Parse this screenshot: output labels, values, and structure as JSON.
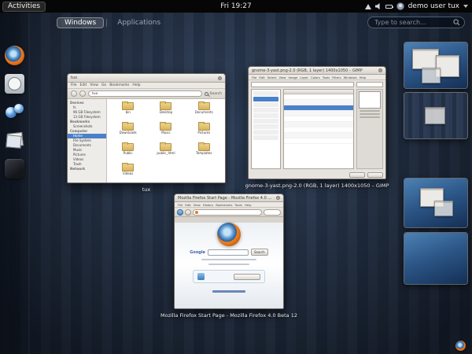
{
  "top_bar": {
    "activities_label": "Activities",
    "clock": "Fri 19:27",
    "user_name": "demo user tux"
  },
  "overview": {
    "tab_windows": "Windows",
    "tab_applications": "Applications",
    "search_placeholder": "Type to search..."
  },
  "dash": {
    "items": [
      "Firefox",
      "Screenshot",
      "Spheres App",
      "Image Viewer",
      "Media Player"
    ]
  },
  "windows": {
    "nautilus": {
      "title": "tux",
      "caption": "tux",
      "menus": [
        "File",
        "Edit",
        "View",
        "Go",
        "Bookmarks",
        "Help"
      ],
      "location": "tux",
      "search_label": "Search",
      "sidebar": [
        {
          "label": "Devices"
        },
        {
          "label": "fs"
        },
        {
          "label": "96 GB Filesystem"
        },
        {
          "label": "13 GB Filesystem"
        },
        {
          "label": "Bookmarks"
        },
        {
          "label": "Screenshots"
        },
        {
          "label": "Computer"
        },
        {
          "label": "Home"
        },
        {
          "label": "File System"
        },
        {
          "label": "Documents"
        },
        {
          "label": "Music"
        },
        {
          "label": "Pictures"
        },
        {
          "label": "Videos"
        },
        {
          "label": "Trash"
        },
        {
          "label": "Network"
        }
      ],
      "folders": [
        "bin",
        "Desktop",
        "Documents",
        "Downloads",
        "Music",
        "Pictures",
        "Public",
        "public_html",
        "Templates",
        "Videos"
      ]
    },
    "gimp": {
      "title": "gnome-3-yast.png-2.0 (RGB, 1 layer) 1400x1050 – GIMP",
      "caption": "gnome-3-yast.png-2.0 (RGB, 1 layer) 1400x1050 – GIMP",
      "menus": [
        "File",
        "Edit",
        "Select",
        "View",
        "Image",
        "Layer",
        "Colors",
        "Tools",
        "Filters",
        "Windows",
        "Help"
      ]
    },
    "firefox": {
      "title": "Mozilla Firefox Start Page - Mozilla Firefox 4.0 Beta 12",
      "caption": "Mozilla Firefox Start Page - Mozilla Firefox 4.0 Beta 12",
      "menus": [
        "File",
        "Edit",
        "View",
        "History",
        "Bookmarks",
        "Tools",
        "Help"
      ],
      "google_label": "Google",
      "search_button": "Search"
    }
  },
  "colors": {
    "selection_blue": "#4a80c8",
    "overview_stripe": "#2c3b53",
    "wallpaper_blue": "#2d5889",
    "panel_black": "#060606"
  }
}
